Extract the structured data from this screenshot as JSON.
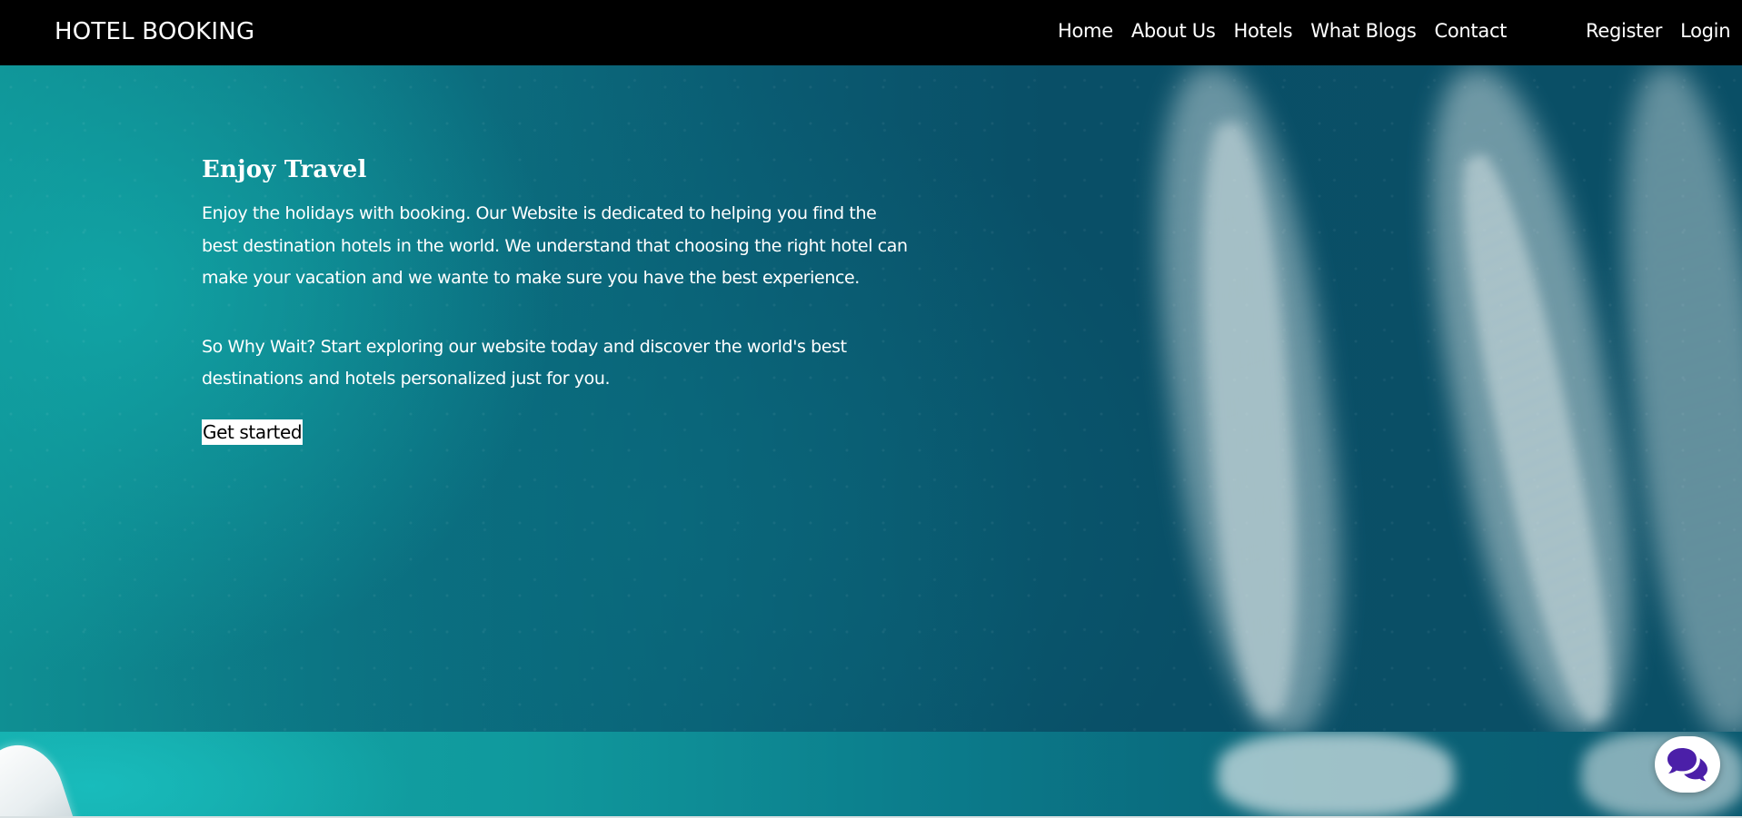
{
  "navbar": {
    "brand": "HOTEL BOOKING",
    "links": [
      {
        "label": "Home"
      },
      {
        "label": "About Us"
      },
      {
        "label": "Hotels"
      },
      {
        "label": "What Blogs"
      },
      {
        "label": "Contact"
      }
    ],
    "auth": [
      {
        "label": "Register"
      },
      {
        "label": "Login"
      }
    ]
  },
  "hero": {
    "title": "Enjoy Travel",
    "paragraph1": "Enjoy the holidays with booking. Our Website is dedicated to helping you find the best destination hotels in the world. We understand that choosing the right hotel can make your vacation and we wante to make sure you have the best experience.",
    "paragraph2": "So Why Wait? Start exploring our website today and discover the world's best destinations and hotels personalized just for you.",
    "cta_label": "Get started"
  },
  "chat_widget": {
    "icon": "chat-bubbles-icon",
    "color": "#4b1fa8"
  },
  "colors": {
    "navbar_bg": "#000000",
    "text": "#ffffff",
    "ocean_teal": "#0f8f93",
    "ocean_deep": "#0a4f66"
  }
}
